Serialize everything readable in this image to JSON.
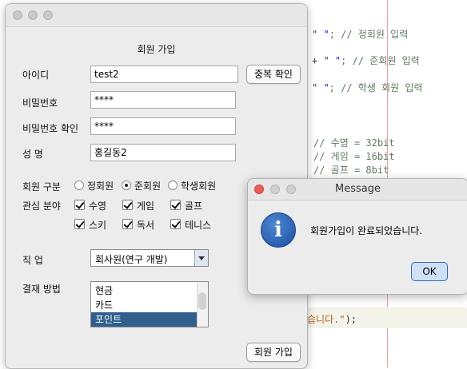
{
  "editor": {
    "lines": [
      {
        "plain": "\"",
        "str": " \"",
        "cmt": "; // 정회원 입력"
      },
      {
        "plain": "+ \"",
        "str": " \"",
        "cmt": "; // 준회원 입력"
      },
      {
        "plain": "\"",
        "str": " \"",
        "cmt": "; // 학생 회원 입력"
      },
      {
        "cmt": "// 수영 = 32bit"
      },
      {
        "cmt": "// 게임 = 16bit"
      },
      {
        "cmt": "// 골프 = 8bit"
      },
      {
        "org": "습니다.\"",
        "plain": ");"
      }
    ]
  },
  "window": {
    "title": "회원 가입",
    "id": {
      "label": "아이디",
      "value": "test2",
      "check_button": "중복 확인"
    },
    "password": {
      "label": "비밀번호",
      "value": "****"
    },
    "password_confirm": {
      "label": "비밀번호 확인",
      "value": "****"
    },
    "name": {
      "label": "성 명",
      "value": "홍길동2"
    },
    "member_type": {
      "label": "회원 구분",
      "options": [
        "정회원",
        "준회원",
        "학생회원"
      ],
      "selected": "준회원"
    },
    "interests": {
      "label": "관심 분야",
      "options": [
        "수영",
        "게임",
        "골프",
        "스키",
        "독서",
        "테니스"
      ],
      "checked": [
        "수영",
        "게임",
        "골프",
        "스키",
        "독서",
        "테니스"
      ]
    },
    "job": {
      "label": "직 업",
      "selected": "회사원(연구 개발)"
    },
    "payment": {
      "label": "결재 방법",
      "options": [
        "현금",
        "카드",
        "포인트"
      ],
      "selected": "포인트"
    },
    "submit_button": "회원 가입"
  },
  "dialog": {
    "title": "Message",
    "message": "회원가입이 완료되었습니다.",
    "ok_button": "OK",
    "icon": "info-icon"
  },
  "colors": {
    "selection": "#2f5f8c",
    "ok_border": "#2f6bbf",
    "close_red": "#ee5b55"
  }
}
